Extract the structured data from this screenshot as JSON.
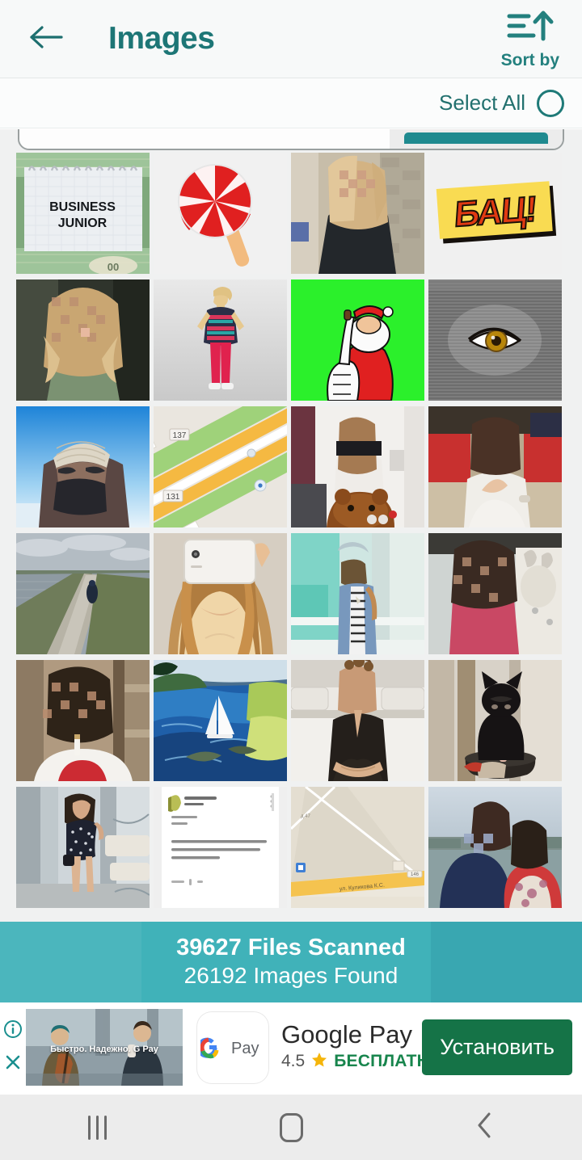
{
  "header": {
    "back_icon": "arrow-left-icon",
    "title": "Images",
    "sort_icon": "sort-ascending-icon",
    "sort_label": "Sort by"
  },
  "select_bar": {
    "label": "Select All",
    "checkbox_state": "unchecked"
  },
  "search_strip": {
    "visible": "partially scrolled off",
    "button_color": "#1f8a8f"
  },
  "grid": {
    "columns": 4,
    "items": [
      {
        "name": "business-junior-notebook",
        "alt": "Notebook page reading BUSINESS JUNIOR on banknotes",
        "caption_line1": "BUSINESS",
        "caption_line2": "JUNIOR"
      },
      {
        "name": "candy-lollipop",
        "alt": "Red and white swirl lollipop on stick"
      },
      {
        "name": "blonde-girl-selfie",
        "alt": "Blonde girl in black t-shirt, face pixelated"
      },
      {
        "name": "bats-meme-card",
        "alt": "Red comic text on yellow card",
        "caption": "БАЦ!"
      },
      {
        "name": "curly-hair-portrait",
        "alt": "Person with curly blonde hair in green hoodie, face pixelated"
      },
      {
        "name": "girl-standing-studio",
        "alt": "Girl in patterned tunic and red leggings on grey backdrop"
      },
      {
        "name": "santa-thumbs-up",
        "alt": "Cartoon Santa giving thumbs up on green screen"
      },
      {
        "name": "eye-optical-illusion",
        "alt": "Brown eye on grey striped moire pattern"
      },
      {
        "name": "winter-portrait-sky",
        "alt": "Person in hat and face mask against blue sky"
      },
      {
        "name": "map-screenshot-roads",
        "alt": "Map screenshot with roads",
        "label_a": "137",
        "label_b": "131"
      },
      {
        "name": "person-with-teddy-bear",
        "alt": "Person holding brown teddy bear, face pixelated"
      },
      {
        "name": "person-red-booth",
        "alt": "Person in white top in red booth, face pixelated"
      },
      {
        "name": "coastal-path-walker",
        "alt": "Person walking a path beside a grey lake"
      },
      {
        "name": "phone-mirror-selfie",
        "alt": "Woman with long curly hair holding white phone"
      },
      {
        "name": "girl-denim-jacket",
        "alt": "Girl in denim jacket and striped top, face pixelated"
      },
      {
        "name": "girl-pink-top-cat",
        "alt": "Girl in pink top with cat, face pixelated"
      },
      {
        "name": "person-cigarette",
        "alt": "Person in red and white shirt smoking, face pixelated"
      },
      {
        "name": "sailboat-painting",
        "alt": "Painting of sailboat on blue bay with green shore"
      },
      {
        "name": "woman-black-blouse",
        "alt": "Woman in black blouse with arms crossed, face pixelated"
      },
      {
        "name": "black-cat-sitting",
        "alt": "Black cat sitting upright indoors"
      },
      {
        "name": "mirror-selfie-dress",
        "alt": "Woman in polka dot dress taking mirror selfie"
      },
      {
        "name": "text-post-screenshot",
        "alt": "Screenshot of a text post with avatar and paragraphs"
      },
      {
        "name": "map-screenshot-street",
        "alt": "Map screenshot with yellow street"
      },
      {
        "name": "couple-outdoors",
        "alt": "Couple outdoors, faces pixelated"
      }
    ]
  },
  "scan_status": {
    "files_scanned": "39627 Files Scanned",
    "images_found": "26192 Images Found",
    "band_color": "#26a7af"
  },
  "ad": {
    "info_icon": "info-icon",
    "close_icon": "close-icon",
    "media_caption": "Быстро. Надежно. G Pay",
    "app_icon": "google-pay-icon",
    "app_icon_label": "Pay",
    "title": "Google Pay",
    "rating": "4.5",
    "star_icon": "star-icon",
    "price_label": "БЕСПЛАТНО",
    "cta_label": "Установить",
    "cta_color": "#157347"
  },
  "navbar": {
    "recents_label": "recents-icon",
    "home_label": "home-icon",
    "back_label": "back-icon"
  }
}
